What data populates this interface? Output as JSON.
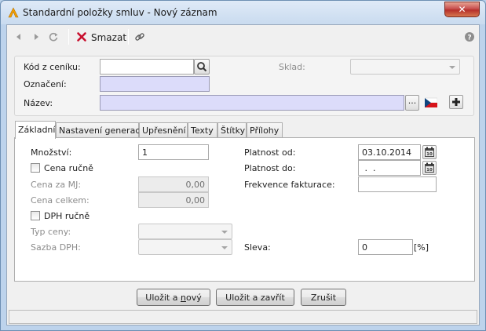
{
  "window": {
    "title": "Standardní položky smluv - Nový záznam",
    "close_glyph": "✕"
  },
  "toolbar": {
    "delete_label": "Smazat",
    "icons": [
      "back-arrow-icon",
      "forward-arrow-icon",
      "refresh-icon",
      "delete-x-icon",
      "link-icon",
      "help-icon"
    ]
  },
  "header": {
    "price_code_label": "Kód z ceníku:",
    "price_code_value": "",
    "warehouse_label": "Sklad:",
    "warehouse_value": "",
    "designation_label": "Označení:",
    "designation_value": "",
    "name_label": "Název:",
    "name_value": "",
    "ellipsis_label": "..."
  },
  "tabs": [
    {
      "label": "Základní",
      "active": true
    },
    {
      "label": "Nastavení generace",
      "active": false
    },
    {
      "label": "Upřesnění",
      "active": false
    },
    {
      "label": "Texty",
      "active": false
    },
    {
      "label": "Štítky",
      "active": false
    },
    {
      "label": "Přílohy",
      "active": false
    }
  ],
  "basic": {
    "quantity_label": "Množství:",
    "quantity_value": "1",
    "manual_price_label": "Cena ručně",
    "unit_price_label": "Cena za MJ:",
    "unit_price_value": "0,00",
    "total_price_label": "Cena celkem:",
    "total_price_value": "0,00",
    "manual_vat_label": "DPH ručně",
    "price_type_label": "Typ ceny:",
    "vat_rate_label": "Sazba DPH:",
    "valid_from_label": "Platnost od:",
    "valid_from_value": "03.10.2014",
    "valid_to_label": "Platnost do:",
    "valid_to_value": " .  .",
    "billing_frequency_label": "Frekvence fakturace:",
    "billing_frequency_value": "",
    "discount_label": "Sleva:",
    "discount_value": "0",
    "discount_unit": "[%]",
    "calendar_day": "10"
  },
  "buttons": {
    "save_new_prefix": "Uložit a ",
    "save_new_underlined": "n",
    "save_new_suffix": "ový",
    "save_close": "Uložit a zavřít",
    "cancel": "Zrušit"
  },
  "colors": {
    "required_field": "#dcdcfa",
    "delete_red": "#c8102e",
    "title_icon_orange": "#f5a000"
  }
}
